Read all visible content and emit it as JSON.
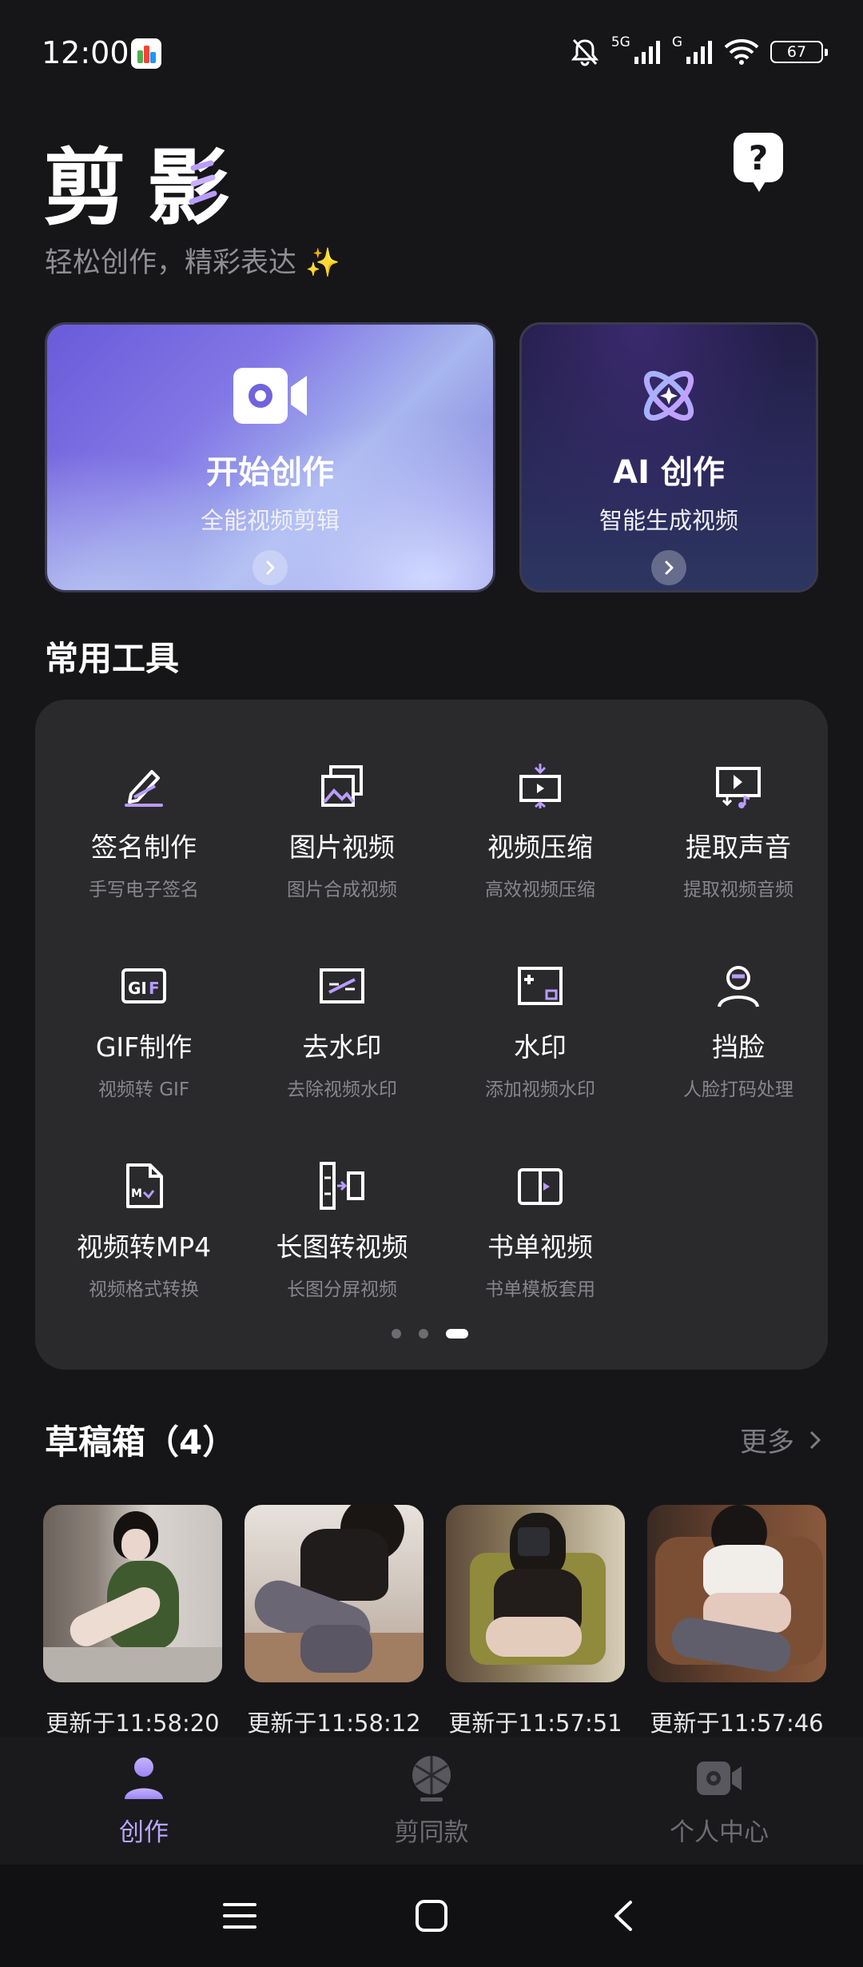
{
  "status_bar": {
    "time": "12:00",
    "network_label_1": "5G",
    "network_label_2": "G",
    "battery": "67",
    "icons": [
      "mute-icon",
      "signal-icon",
      "signal-icon",
      "wifi-icon",
      "battery-icon"
    ]
  },
  "header": {
    "title_part1": "剪",
    "title_part2": "影",
    "tagline": "轻松创作，精彩表达 ✨",
    "help_icon": "help-chat-icon"
  },
  "hero": {
    "create": {
      "title": "开始创作",
      "subtitle": "全能视频剪辑",
      "icon": "video-camera-icon"
    },
    "ai": {
      "title": "AI 创作",
      "subtitle": "智能生成视频",
      "icon": "atom-icon"
    }
  },
  "tools": {
    "section_title": "常用工具",
    "items": [
      {
        "label": "签名制作",
        "sub": "手写电子签名",
        "icon": "signature-pen-icon"
      },
      {
        "label": "图片视频",
        "sub": "图片合成视频",
        "icon": "images-icon"
      },
      {
        "label": "视频压缩",
        "sub": "高效视频压缩",
        "icon": "compress-icon"
      },
      {
        "label": "提取声音",
        "sub": "提取视频音频",
        "icon": "extract-audio-icon"
      },
      {
        "label": "GIF制作",
        "sub": "视频转 GIF",
        "icon": "gif-icon"
      },
      {
        "label": "去水印",
        "sub": "去除视频水印",
        "icon": "remove-watermark-icon"
      },
      {
        "label": "水印",
        "sub": "添加视频水印",
        "icon": "add-watermark-icon"
      },
      {
        "label": "挡脸",
        "sub": "人脸打码处理",
        "icon": "face-mask-icon"
      },
      {
        "label": "视频转MP4",
        "sub": "视频格式转换",
        "icon": "mp4-file-icon"
      },
      {
        "label": "长图转视频",
        "sub": "长图分屏视频",
        "icon": "long-image-icon"
      },
      {
        "label": "书单视频",
        "sub": "书单模板套用",
        "icon": "book-icon"
      }
    ],
    "page_count": 3,
    "active_page": 3
  },
  "drafts": {
    "title": "草稿箱（4）",
    "more": "更多",
    "items": [
      {
        "time": "更新于11:58:20"
      },
      {
        "time": "更新于11:58:12"
      },
      {
        "time": "更新于11:57:51"
      },
      {
        "time": "更新于11:57:46"
      }
    ]
  },
  "bottom_nav": {
    "items": [
      {
        "label": "创作",
        "icon": "person-icon",
        "active": true
      },
      {
        "label": "剪同款",
        "icon": "template-ball-icon",
        "active": false
      },
      {
        "label": "个人中心",
        "icon": "profile-camera-icon",
        "active": false
      }
    ]
  },
  "system_nav": [
    "menu-icon",
    "home-icon",
    "back-icon"
  ],
  "colors": {
    "background": "#161618",
    "panel": "#2a2a2d",
    "accent": "#b89cff",
    "muted_text": "#86868c"
  }
}
